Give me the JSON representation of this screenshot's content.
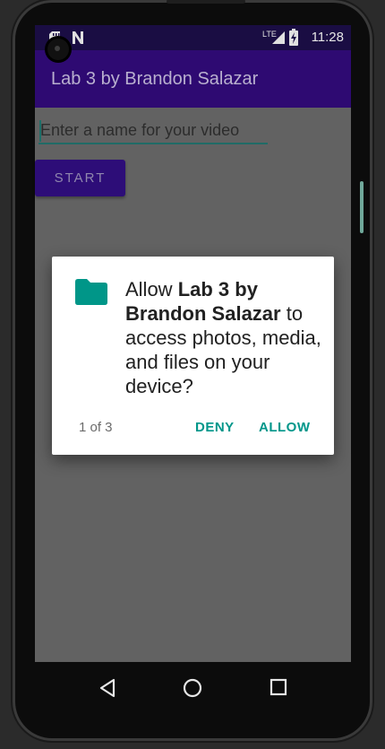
{
  "status_bar": {
    "time": "11:28",
    "network_label": "LTE",
    "icons": [
      "sd-card-icon",
      "n-notification-icon",
      "lte-signal-icon",
      "battery-charging-icon"
    ]
  },
  "app_bar": {
    "title": "Lab 3 by Brandon Salazar"
  },
  "main": {
    "video_name_input": {
      "placeholder": "Enter a name for your video",
      "value": ""
    },
    "start_button": {
      "label": "START"
    }
  },
  "permission_dialog": {
    "icon": "folder-icon",
    "message_prefix": "Allow ",
    "app_name": "Lab 3 by Brandon Salazar",
    "message_suffix": " to access photos, media, and files on your device?",
    "counter": "1 of 3",
    "deny_label": "DENY",
    "allow_label": "ALLOW"
  },
  "nav_bar": {
    "buttons": [
      "back-icon",
      "home-icon",
      "recents-icon"
    ]
  },
  "colors": {
    "status_bar": "#1a0d43",
    "app_bar": "#2e0a72",
    "screen_dim": "#626262",
    "accent_teal": "#009688",
    "dialog_bg": "#ffffff"
  }
}
